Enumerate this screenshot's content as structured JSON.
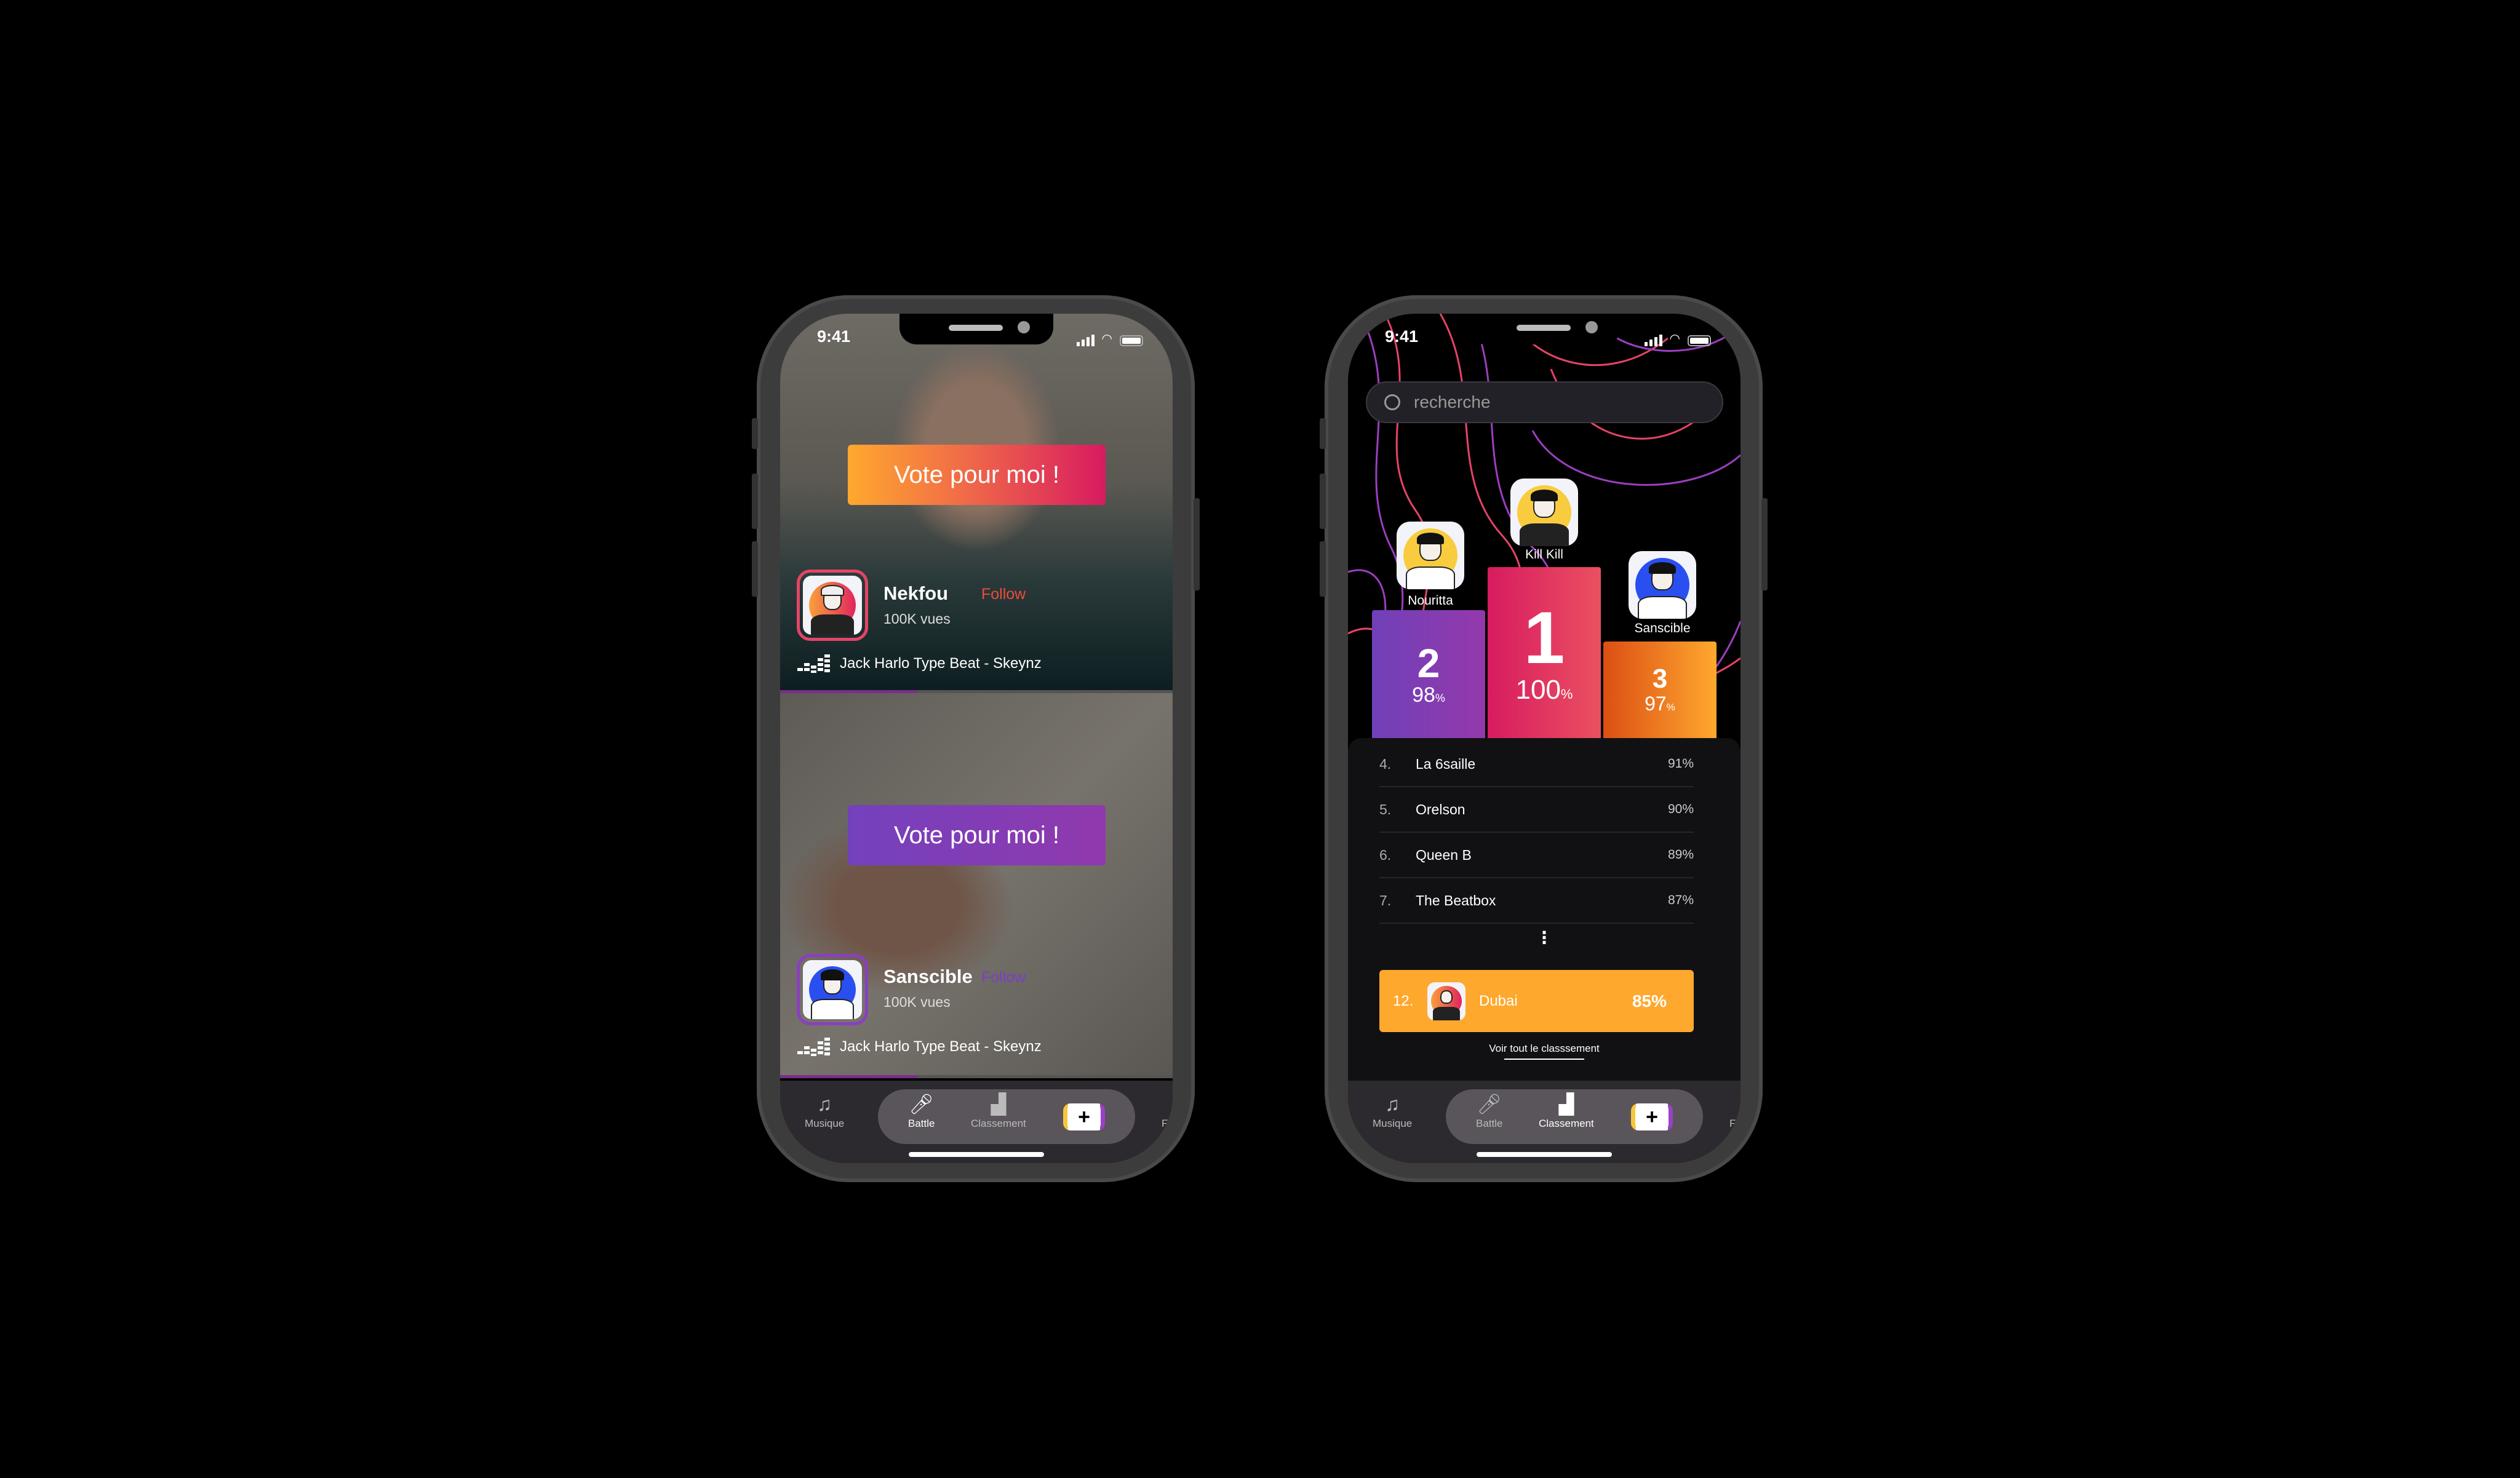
{
  "status": {
    "time": "9:41"
  },
  "battle": {
    "vote_label": "Vote pour moi !",
    "artists": [
      {
        "name": "Nekfou",
        "follow": "Follow",
        "views": "100K vues",
        "track": "Jack Harlo Type Beat - Skeynz",
        "accent": "#e64466"
      },
      {
        "name": "Sanscible",
        "follow": "Follow",
        "views": "100K vues",
        "track": "Jack Harlo Type Beat - Skeynz",
        "accent": "#8a3fbf"
      }
    ]
  },
  "ranking": {
    "search_placeholder": "recherche",
    "podium": [
      {
        "rank": "1",
        "name": "Kill Kill",
        "score": "100",
        "unit": "%"
      },
      {
        "rank": "2",
        "name": "Nouritta",
        "score": "98",
        "unit": "%"
      },
      {
        "rank": "3",
        "name": "Sanscible",
        "score": "97",
        "unit": "%"
      }
    ],
    "list": [
      {
        "rank": "4.",
        "name": "La 6saille",
        "score": "91%"
      },
      {
        "rank": "5.",
        "name": "Orelson",
        "score": "90%"
      },
      {
        "rank": "6.",
        "name": "Queen B",
        "score": "89%"
      },
      {
        "rank": "7.",
        "name": "The Beatbox",
        "score": "87%"
      }
    ],
    "more": "⋮",
    "me": {
      "rank": "12.",
      "name": "Dubai",
      "score": "85%"
    },
    "see_all": "Voir tout le classsement"
  },
  "tabs": [
    {
      "label": "Musique",
      "icon": "music-note-icon"
    },
    {
      "label": "Battle",
      "icon": "microphone-icon"
    },
    {
      "label": "Classement",
      "icon": "podium-icon"
    },
    {
      "label": "+",
      "icon": "plus-icon"
    },
    {
      "label": "Fa",
      "icon": "favorites-icon"
    }
  ],
  "colors": {
    "orange": "#ffa82e",
    "pink": "#d81b60",
    "purple": "#7a3fbf",
    "tabbar": "#2d2a2f"
  }
}
